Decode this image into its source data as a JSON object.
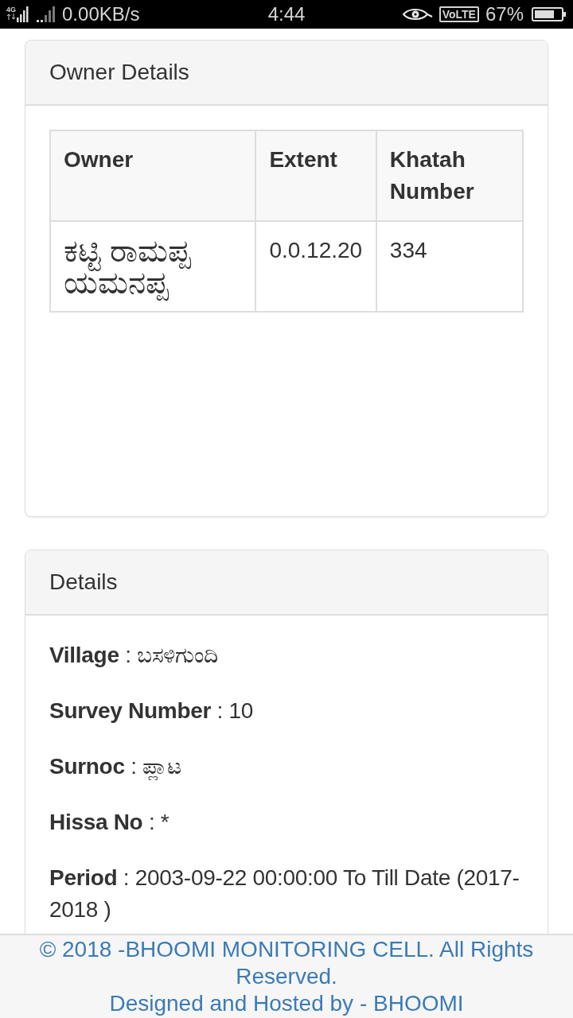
{
  "status_bar": {
    "network_type": "4G",
    "data_rate": "0.00KB/s",
    "time": "4:44",
    "volte": "VoLTE",
    "battery": "67%"
  },
  "owner_details": {
    "title": "Owner Details",
    "table": {
      "columns": [
        "Owner",
        "Extent",
        "Khatah Number"
      ],
      "rows": [
        [
          "ಕಟ್ಟಿ ರಾಮಪ್ಪ ಯಮನಪ್ಪ",
          "0.0.12.20",
          "334"
        ]
      ]
    }
  },
  "details": {
    "title": "Details",
    "lines": [
      {
        "label": "Village",
        "value": ": ಬಸಳಿಗುಂದಿ"
      },
      {
        "label": "Survey Number",
        "value": ": 10"
      },
      {
        "label": "Surnoc",
        "value": ": ಪ್ಲಾಟ"
      },
      {
        "label": "Hissa No",
        "value": ": *"
      },
      {
        "label": "Period",
        "value": ": 2003-09-22 00:00:00 To Till Date (2017-2018 )"
      }
    ]
  },
  "footer": {
    "lines": [
      "© 2018 -BHOOMI MONITORING CELL. All Rights Reserved.",
      "Designed and Hosted by - BHOOMI"
    ]
  }
}
